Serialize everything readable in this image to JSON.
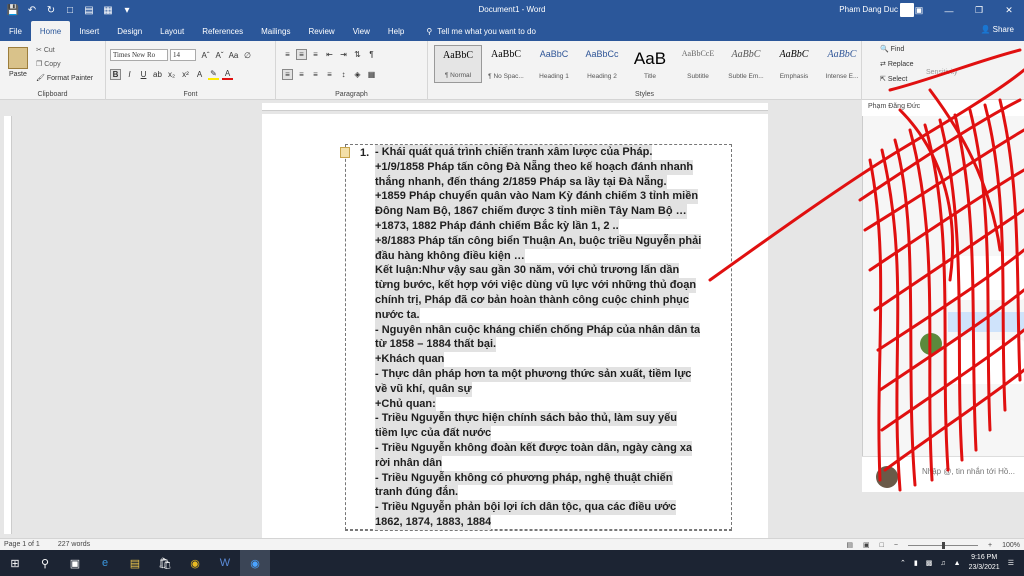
{
  "window": {
    "title": "Document1 - Word",
    "user": "Pham Dang Duc",
    "share_label": "Share"
  },
  "tabs": [
    "File",
    "Home",
    "Insert",
    "Design",
    "Layout",
    "References",
    "Mailings",
    "Review",
    "View",
    "Help"
  ],
  "tell_me": "Tell me what you want to do",
  "clipboard": {
    "paste": "Paste",
    "cut": "Cut",
    "copy": "Copy",
    "format_painter": "Format Painter",
    "group_label": "Clipboard"
  },
  "font": {
    "family": "Times New Ro",
    "size": "14",
    "group_label": "Font"
  },
  "paragraph": {
    "group_label": "Paragraph"
  },
  "styles": {
    "group_label": "Styles",
    "items": [
      {
        "sample": "AaBbC",
        "name": "¶ Normal"
      },
      {
        "sample": "AaBbC",
        "name": "¶ No Spac..."
      },
      {
        "sample": "AaBbC",
        "name": "Heading 1"
      },
      {
        "sample": "AaBbCc",
        "name": "Heading 2"
      },
      {
        "sample": "AaB",
        "name": "Title"
      },
      {
        "sample": "AaBbCcE",
        "name": "Subtitle"
      },
      {
        "sample": "AaBbC",
        "name": "Subtle Em..."
      },
      {
        "sample": "AaBbC",
        "name": "Emphasis"
      },
      {
        "sample": "AaBbC",
        "name": "Intense E..."
      }
    ]
  },
  "editing": {
    "find": "Find",
    "replace": "Replace",
    "select": "Select",
    "sensitivity": "Sensitivity"
  },
  "document": {
    "list_number": "1.",
    "lines": [
      "- Khái quát quá trình chiến tranh xâm lược của Pháp.",
      "+1/9/1858 Pháp tấn công Đà Nẵng theo kế hoạch đánh nhanh",
      "thắng nhanh, đến tháng 2/1859 Pháp sa lầy tại Đà Nẵng.",
      "+1859 Pháp chuyển quân vào Nam Kỳ đánh chiếm 3 tỉnh miền",
      "Đông Nam Bộ, 1867 chiếm được 3 tỉnh miền Tây Nam Bộ …",
      "+1873, 1882 Pháp đánh chiếm Bắc kỳ lần 1, 2 ..",
      "+8/1883 Pháp tấn công biển Thuận An, buộc triều Nguyễn phải",
      "đầu hàng không điều kiện …",
      "Kết luận:Như vậy sau gần 30 năm, với chủ trương lấn dần",
      "từng bước, kết hợp với việc dùng vũ lực với những thủ đoạn",
      "chính trị, Pháp đã cơ bản hoàn thành công cuộc chinh phục",
      "nước ta.",
      "- Nguyên nhân cuộc kháng chiến chống Pháp của nhân dân ta",
      "từ 1858 – 1884 thất bại.",
      "+Khách quan",
      "- Thực dân pháp hơn ta một phương thức sản xuất, tiềm lực",
      "về vũ khí, quân sự",
      "+Chủ quan:",
      "- Triều Nguyễn thực hiện chính sách bảo thủ, làm suy yếu",
      "tiềm lực của đất nước",
      "- Triều Nguyễn không đoàn kết được toàn dân, ngày càng xa",
      "rời nhân dân",
      "- Triều Nguyễn không có phương pháp, nghệ thuật chiến",
      "tranh đúng đắn.",
      "- Triều Nguyễn phản bội lợi ích dân tộc, qua các điều ước",
      "1862, 1874, 1883, 1884"
    ]
  },
  "chat": {
    "header_name": "Phạm Đăng Đức",
    "input_placeholder": "Nhập @, tin nhắn tới Hồ..."
  },
  "status": {
    "page": "Page 1 of 1",
    "words": "227 words",
    "zoom": "100%"
  },
  "taskbar": {
    "time": "9:16 PM",
    "date": "23/3/2021"
  },
  "colors": {
    "word_blue": "#2b579a",
    "scribble_red": "#e01010"
  }
}
